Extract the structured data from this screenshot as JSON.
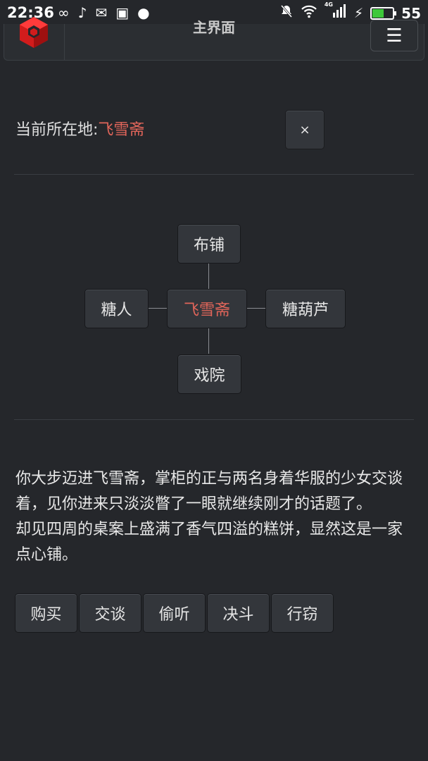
{
  "status_bar": {
    "time": "22:36",
    "left_icons": [
      "infinity-icon",
      "tiktok-icon",
      "mail-icon",
      "image-icon",
      "chat-icon"
    ],
    "signal_label": "4G",
    "battery_level": "55"
  },
  "header": {
    "title": "主界面",
    "menu_icon": "☰"
  },
  "location": {
    "label": "当前所在地:",
    "place": "飞雪斋",
    "close_label": "×"
  },
  "map": {
    "north": "布铺",
    "west": "糖人",
    "center": "飞雪斋",
    "east": "糖葫芦",
    "south": "戏院"
  },
  "description": {
    "paragraph1": "你大步迈进飞雪斋，掌柜的正与两名身着华服的少女交谈着，见你进来只淡淡瞥了一眼就继续刚才的话题了。",
    "paragraph2": "却见四周的桌案上盛满了香气四溢的糕饼，显然这是一家点心铺。"
  },
  "actions": [
    "购买",
    "交谈",
    "偷听",
    "决斗",
    "行窃"
  ],
  "colors": {
    "background": "#25272b",
    "highlight": "#e0655a",
    "button": "#33363b"
  }
}
